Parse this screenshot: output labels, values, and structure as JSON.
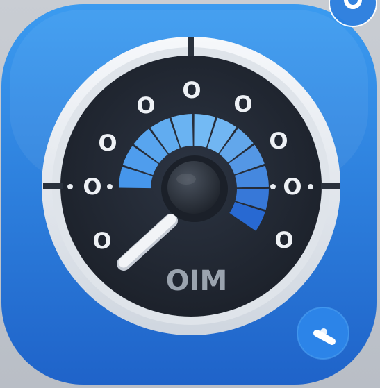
{
  "icon": {
    "name": "speedometer-app-icon",
    "colors": {
      "tile_blue": "#2f86e6",
      "tile_blue_dark": "#1d5fc4",
      "bezel": "#e8ecf1",
      "dial_face": "#232a36",
      "gauge_light": "#53a7f0",
      "gauge_dark": "#2b6fd6",
      "needle": "#f2f4f7",
      "hub": "#2b313b"
    }
  },
  "dial": {
    "markers": [
      "O",
      "O",
      "O",
      "O",
      "O",
      "O",
      "O",
      "O",
      "O",
      "O",
      "O"
    ],
    "readout": "OIM"
  },
  "badge": {
    "icon": "toggle-icon"
  },
  "corner_badge": {
    "icon": "circle-badge-icon"
  }
}
